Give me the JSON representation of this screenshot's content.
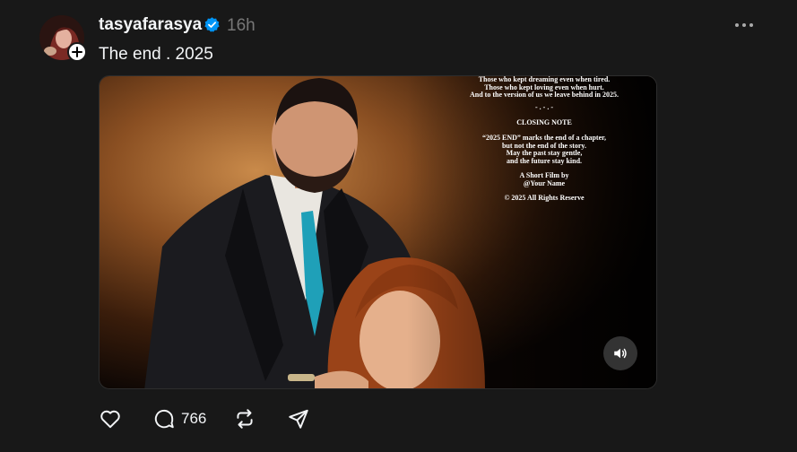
{
  "post": {
    "username": "tasyafarasya",
    "verified": true,
    "timestamp": "16h",
    "caption": "The end . 2025",
    "avatar_icon": "profile-photo",
    "follow_icon": "plus-icon",
    "more_icon": "more-icon"
  },
  "media": {
    "type": "video",
    "overlay": {
      "lines_top": [
        "Those who kept dreaming even when tired.",
        "Those who kept loving even when hurt.",
        "And to the version of us we leave behind in 2025."
      ],
      "divider": "- . - . -",
      "heading": "CLOSING NOTE",
      "quote_lines": [
        "“2025 END” marks the end of a chapter,",
        "but not the end of the story.",
        "May the past stay gentle,",
        "and the future stay kind."
      ],
      "credit_lines": [
        "A Short Film by",
        "@Your Name"
      ],
      "copyright": "© 2025 All Rights Reserve"
    },
    "sound_icon": "speaker-icon"
  },
  "actions": {
    "like_icon": "heart-icon",
    "reply_icon": "comment-icon",
    "reply_count": "766",
    "repost_icon": "repost-icon",
    "share_icon": "send-icon"
  },
  "colors": {
    "background": "#181818",
    "text": "#f3f5f7",
    "muted": "#777777",
    "verified": "#0095f6"
  }
}
